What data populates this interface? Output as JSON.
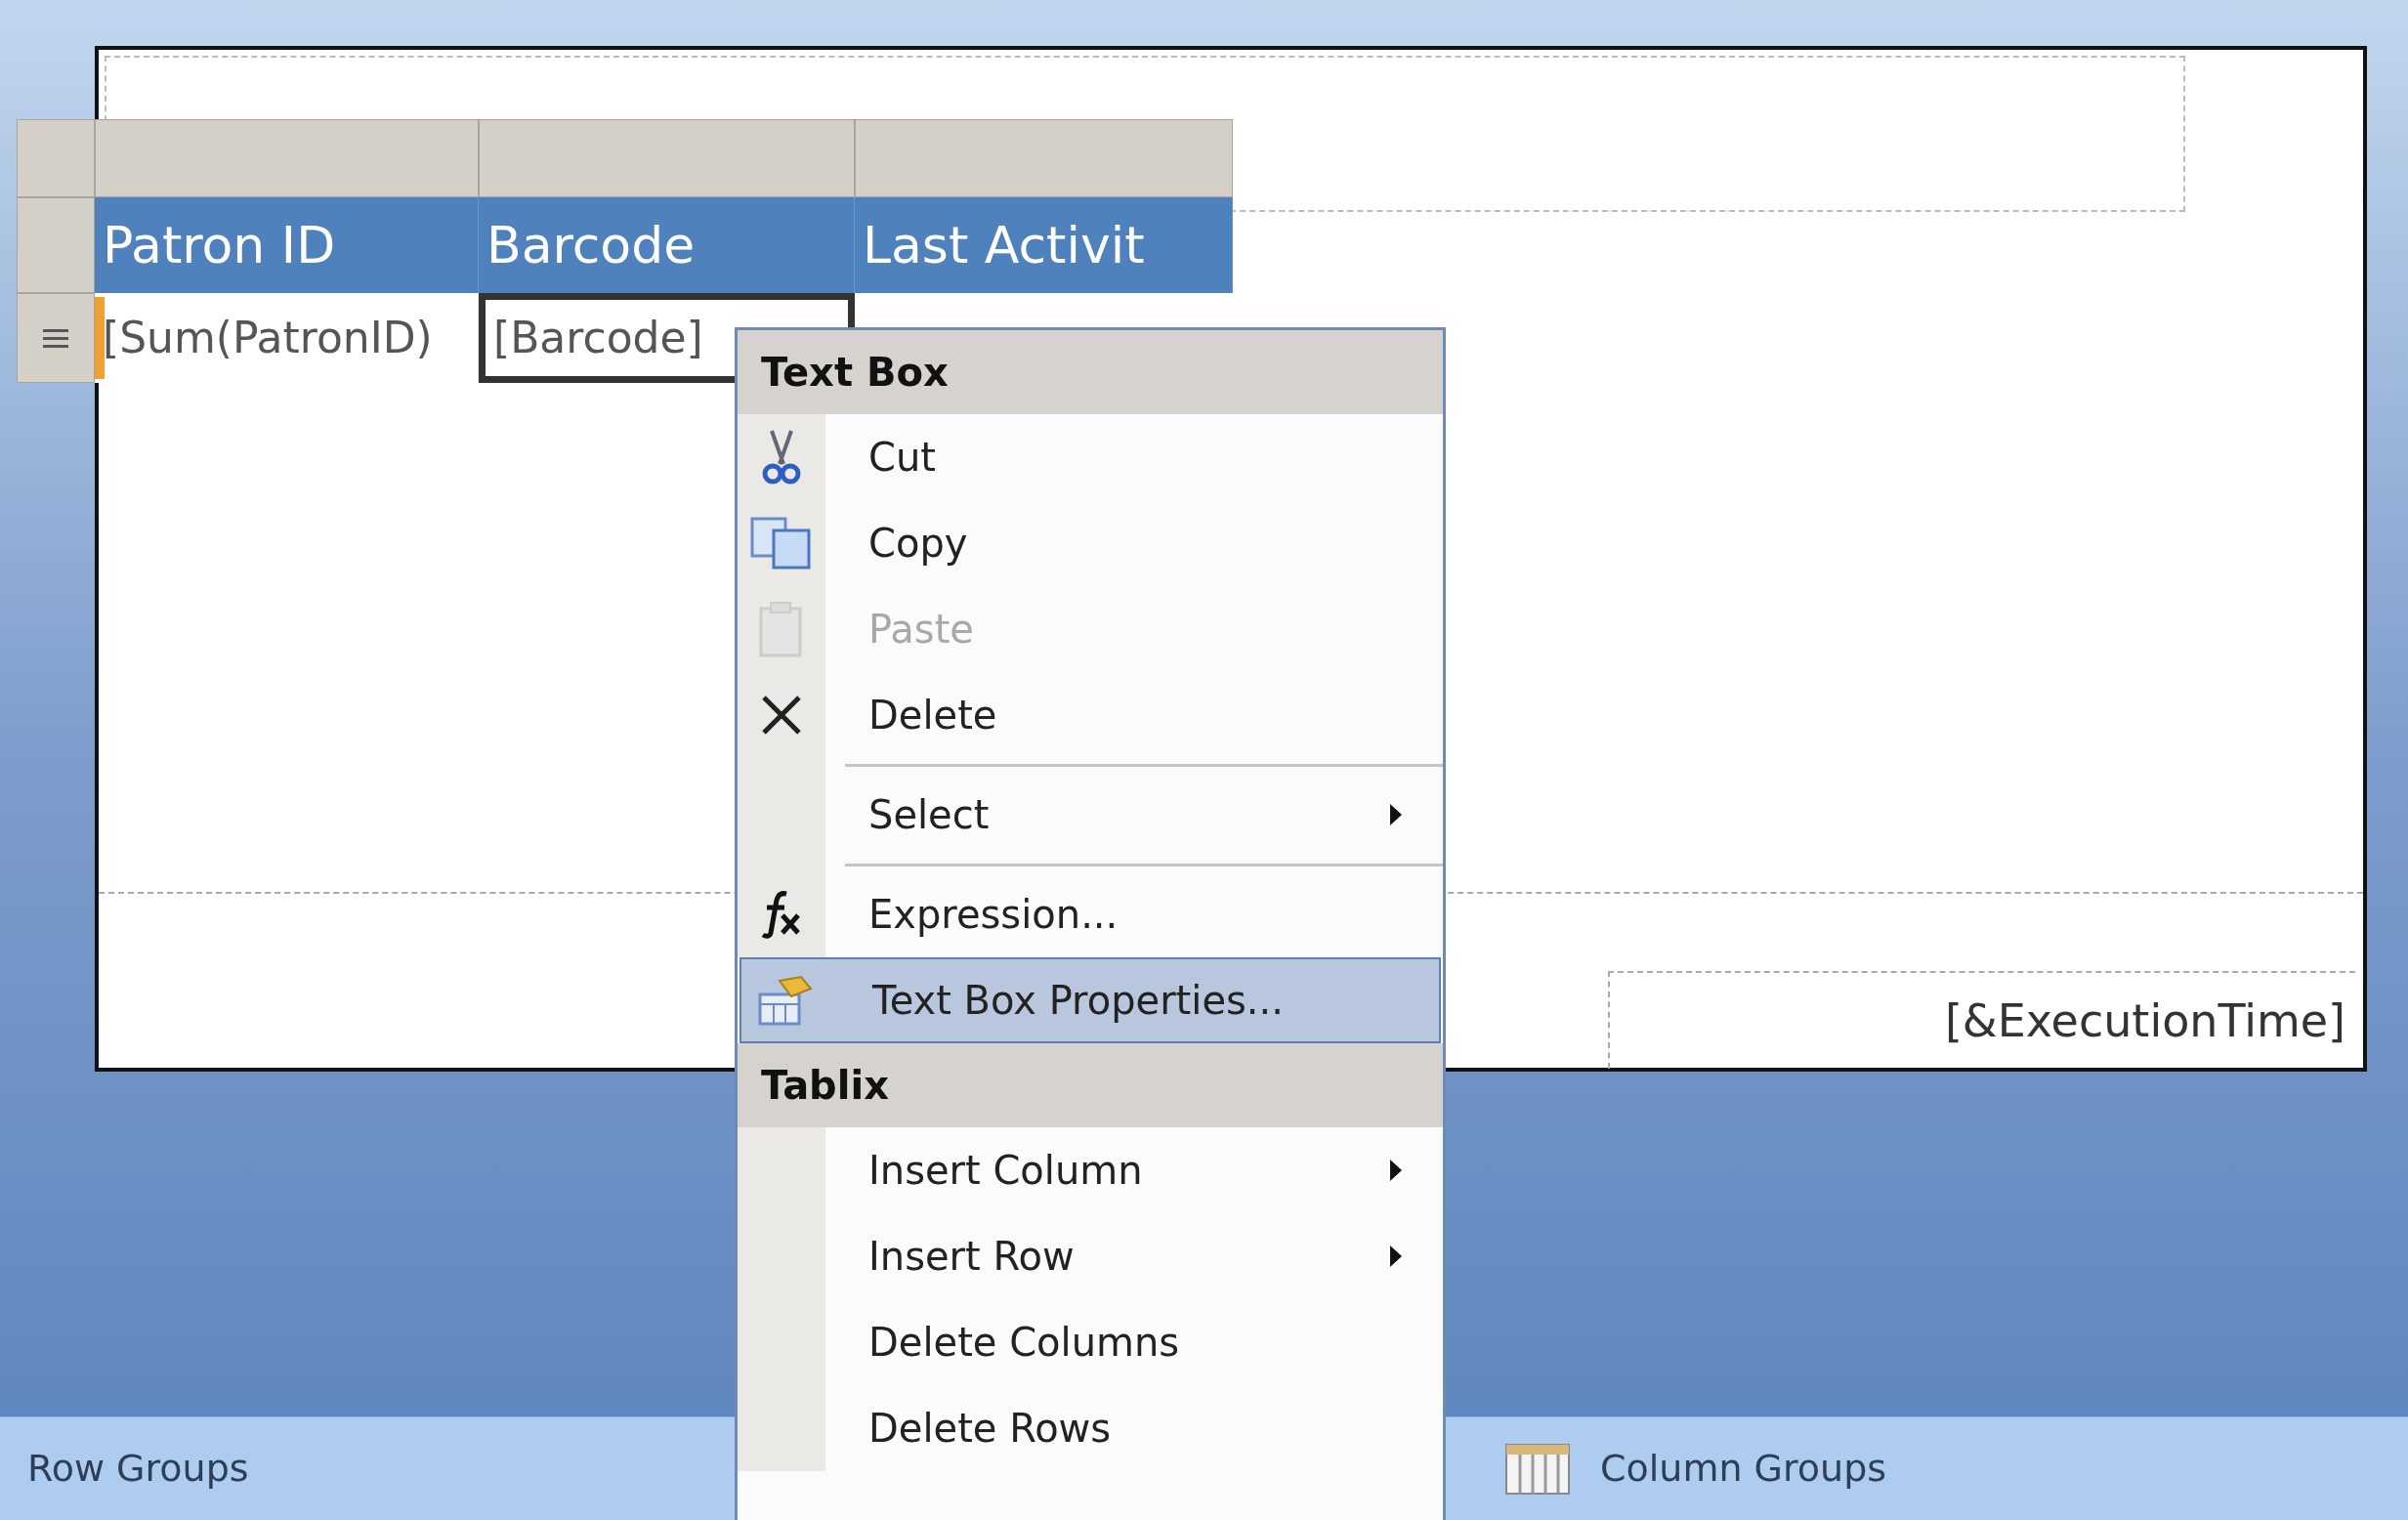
{
  "report": {
    "tablix": {
      "header": [
        "Patron ID",
        "Barcode",
        "Last Activit"
      ],
      "row": [
        {
          "text": "[Sum(PatronID)",
          "selected": false
        },
        {
          "text": "[Barcode]",
          "selected": true
        }
      ]
    },
    "footer_text": "[&ExecutionTime]"
  },
  "context_menu": {
    "sections": [
      {
        "title": "Text Box",
        "items": [
          {
            "label": "Cut",
            "disabled": false,
            "submenu": false,
            "selected": false,
            "separator_before": false
          },
          {
            "label": "Copy",
            "disabled": false,
            "submenu": false,
            "selected": false,
            "separator_before": false
          },
          {
            "label": "Paste",
            "disabled": true,
            "submenu": false,
            "selected": false,
            "separator_before": false
          },
          {
            "label": "Delete",
            "disabled": false,
            "submenu": false,
            "selected": false,
            "separator_before": false
          },
          {
            "label": "Select",
            "disabled": false,
            "submenu": true,
            "selected": false,
            "separator_before": true
          },
          {
            "label": "Expression...",
            "disabled": false,
            "submenu": false,
            "selected": false,
            "separator_before": true
          },
          {
            "label": "Text Box Properties...",
            "disabled": false,
            "submenu": false,
            "selected": true,
            "separator_before": false
          }
        ]
      },
      {
        "title": "Tablix",
        "items": [
          {
            "label": "Insert Column",
            "disabled": false,
            "submenu": true,
            "selected": false,
            "separator_before": false
          },
          {
            "label": "Insert Row",
            "disabled": false,
            "submenu": true,
            "selected": false,
            "separator_before": false
          },
          {
            "label": "Delete Columns",
            "disabled": false,
            "submenu": false,
            "selected": false,
            "separator_before": false
          },
          {
            "label": "Delete Rows",
            "disabled": false,
            "submenu": false,
            "selected": false,
            "separator_before": false
          }
        ]
      }
    ]
  },
  "group_bar": {
    "row_groups": "Row Groups",
    "column_groups": "Column Groups"
  }
}
